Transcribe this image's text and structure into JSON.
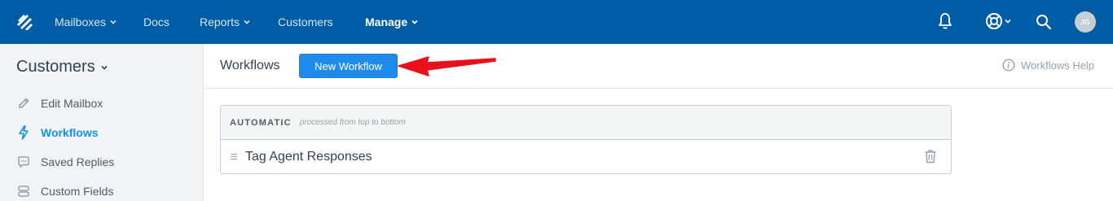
{
  "topnav": {
    "items": [
      {
        "label": "Mailboxes",
        "has_caret": true
      },
      {
        "label": "Docs",
        "has_caret": false
      },
      {
        "label": "Reports",
        "has_caret": true
      },
      {
        "label": "Customers",
        "has_caret": false
      },
      {
        "label": "Manage",
        "has_caret": true,
        "active": true
      }
    ],
    "icons": [
      "helpscout-logo-icon",
      "bell-icon",
      "lifebuoy-icon",
      "search-icon"
    ],
    "avatar_initials": "JG",
    "bg_color": "#005ca4"
  },
  "sidebar": {
    "title": "Customers",
    "items": [
      {
        "label": "Edit Mailbox",
        "icon": "pencil-icon"
      },
      {
        "label": "Workflows",
        "icon": "lightning-bolt-icon",
        "active": true
      },
      {
        "label": "Saved Replies",
        "icon": "chat-bubble-icon"
      },
      {
        "label": "Custom Fields",
        "icon": "fields-icon"
      }
    ]
  },
  "header": {
    "title": "Workflows",
    "new_button_label": "New Workflow",
    "help_label": "Workflows Help"
  },
  "panel": {
    "kind": "AUTOMATIC",
    "subtitle": "processed from top to bottom",
    "rows": [
      {
        "label": "Tag Agent Responses"
      }
    ]
  },
  "colors": {
    "accent": "#1f8ceb",
    "annotation_arrow": "#e8101a"
  }
}
